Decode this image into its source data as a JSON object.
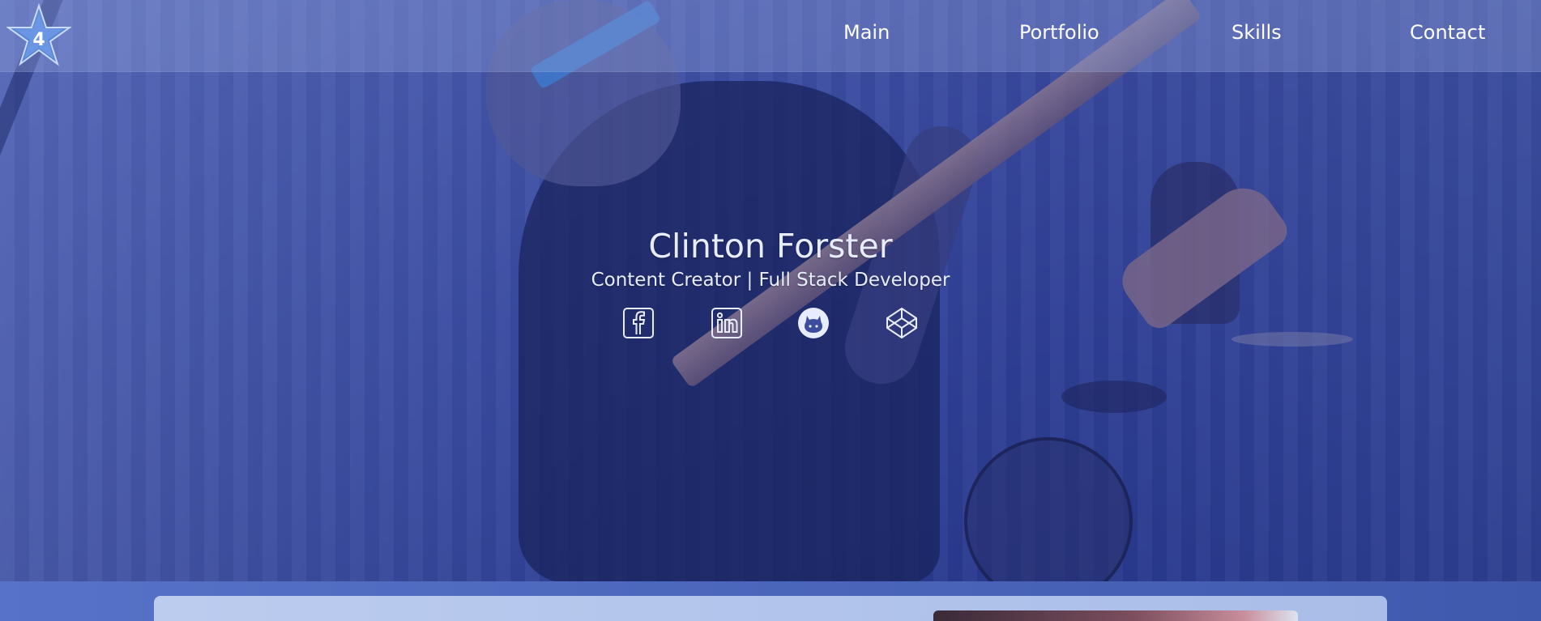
{
  "nav": {
    "logo_text": "4",
    "links": [
      {
        "label": "Main"
      },
      {
        "label": "Portfolio"
      },
      {
        "label": "Skills"
      },
      {
        "label": "Contact"
      }
    ]
  },
  "hero": {
    "name": "Clinton Forster",
    "role": "Content Creator | Full Stack Developer",
    "social": [
      {
        "icon": "facebook-icon"
      },
      {
        "icon": "linkedin-icon"
      },
      {
        "icon": "github-icon"
      },
      {
        "icon": "codepen-icon"
      }
    ]
  },
  "colors": {
    "nav_text": "#ffffff",
    "hero_text": "#e8ecff",
    "overlay": "#3b4d9c",
    "card": "#bcccef"
  }
}
